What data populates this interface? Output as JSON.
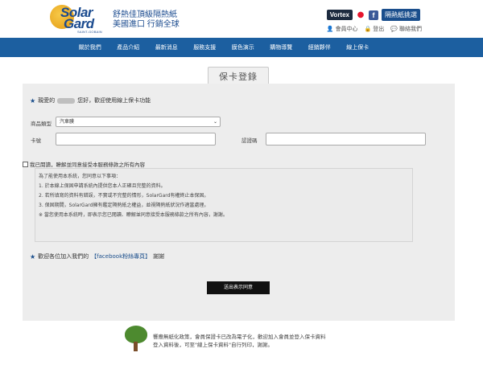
{
  "brand": {
    "logo_line1": "Solar",
    "logo_line2": "Gard",
    "logo_sub": "SAINT-GOBAIN",
    "tagline1": "舒熱佳頂級隔熱紙",
    "tagline2": "美國進口 行銷全球"
  },
  "header": {
    "vortex_label": "Vortex",
    "weibo_label": "癌",
    "fb_label": "f",
    "find_label": "隔熱紙挑選",
    "member_center": "會員中心",
    "logout": "登出",
    "contact": "聯絡我們"
  },
  "nav": {
    "items": [
      "關於我們",
      "產品介紹",
      "最新消息",
      "服務支援",
      "膜色演示",
      "購物導覽",
      "經銷夥伴",
      "線上保卡"
    ]
  },
  "page": {
    "title": "保卡登錄"
  },
  "form": {
    "welcome_prefix": "親愛的",
    "welcome_suffix": "您好，歡迎使用線上保卡功能",
    "product_type_label": "商品類型",
    "product_type_value": "汽車膜",
    "card_no_label": "卡號",
    "verify_code_label": "認證碼",
    "agree_label": "我已閱讀，瞭解並同意接受本服務條款之所有內容",
    "terms": {
      "intro": "為了能使用本系統，您同意以下事項：",
      "item1": "1. 於本線上保固申請系統內提供您本人正確且完整的資料。",
      "item2": "2. 若所填寫的資料有錯誤，不實或不完整的情形，SolarGard有權終止本保固。",
      "item3": "3. 保固期間，SolarGard擁有鑑定隔熱紙之權益，並視隔熱紙狀況作適當處理。",
      "note": "※ 當您使用本系統時，即表示您已閱讀、瞭解並同意接受本服務條款之所有內容，謝謝。"
    },
    "fb_prefix": "歡迎各位加入我們的",
    "fb_link": "【facebook粉絲專頁】",
    "fb_suffix": "謝謝",
    "submit_label": "送出表示同意"
  },
  "footer": {
    "line1": "響應無紙化政策，會員保證卡已改為電子化，歡迎加入會員並登入保卡資料",
    "line2": "登入資料後，可至\"線上保卡資料\"自行列印，謝謝。"
  },
  "colors": {
    "nav_bg": "#1c5fa0",
    "brand_blue": "#1b4b8f",
    "submit_bg": "#111111"
  }
}
